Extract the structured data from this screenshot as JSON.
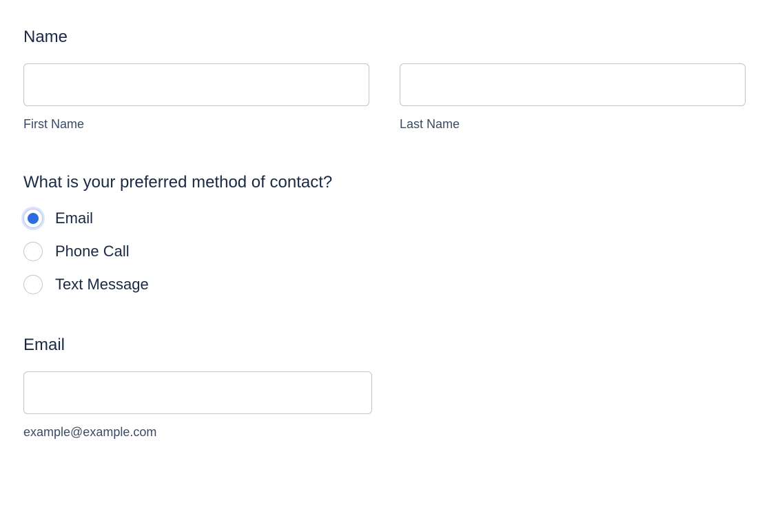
{
  "name": {
    "label": "Name",
    "first_sub": "First Name",
    "last_sub": "Last Name",
    "first_value": "",
    "last_value": ""
  },
  "contact_method": {
    "question": "What is your preferred method of contact?",
    "options": [
      {
        "label": "Email",
        "selected": true
      },
      {
        "label": "Phone Call",
        "selected": false
      },
      {
        "label": "Text Message",
        "selected": false
      }
    ]
  },
  "email": {
    "label": "Email",
    "value": "",
    "helper": "example@example.com"
  }
}
